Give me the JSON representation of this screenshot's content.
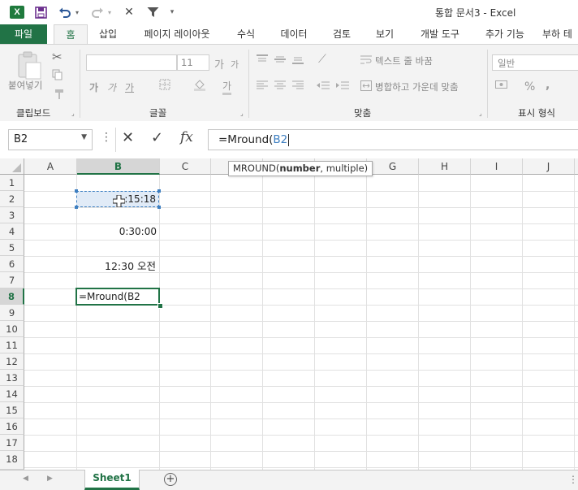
{
  "window": {
    "title": "통합 문서3 - Excel",
    "app_logo": "X"
  },
  "quick_access": {
    "icons": [
      "save-icon",
      "undo-icon",
      "redo-icon",
      "close-x-icon",
      "filter-icon",
      "customize-icon"
    ]
  },
  "ribbon_tabs": [
    "파일",
    "홈",
    "삽입",
    "페이지 레이아웃",
    "수식",
    "데이터",
    "검토",
    "보기",
    "개발 도구",
    "추가 기능",
    "부하 테"
  ],
  "ribbon": {
    "clipboard": {
      "label": "클립보드",
      "paste_label": "붙여넣기"
    },
    "font": {
      "label": "글꼴",
      "size_value": "11",
      "bold": "가",
      "italic": "가",
      "underline": "가",
      "font_color": "가",
      "increase": "가",
      "decrease": "가"
    },
    "alignment": {
      "label": "맞춤",
      "wrap_text": "텍스트 줄 바꿈",
      "merge_center": "병합하고 가운데 맞춤"
    },
    "number": {
      "label": "표시 형식",
      "format_value": "일반",
      "percent": "%",
      "comma": ","
    }
  },
  "formula_bar": {
    "name_box": "B2",
    "cancel_symbol": "✕",
    "enter_symbol": "✓",
    "fx_label": "fx",
    "formula_prefix": "=Mround(",
    "formula_ref": "B2"
  },
  "tooltip": {
    "func": "MROUND(",
    "arg_bold": "number",
    "rest": ", multiple)"
  },
  "columns": [
    "A",
    "B",
    "C",
    "D",
    "E",
    "F",
    "G",
    "H",
    "I",
    "J"
  ],
  "rows": [
    "1",
    "2",
    "3",
    "4",
    "5",
    "6",
    "7",
    "8",
    "9",
    "10",
    "11",
    "12",
    "13",
    "14",
    "15",
    "16",
    "17",
    "18"
  ],
  "cells": {
    "B2": ":15:18",
    "B4": "0:30:00",
    "B6": "12:30 오전",
    "B8_edit_prefix": "=Mround(",
    "B8_edit_ref": "B2"
  },
  "sheet_tabs": {
    "active": "Sheet1",
    "add_symbol": "+"
  },
  "colors": {
    "excel_green": "#217346",
    "ref_blue": "#3e7fc1",
    "selection_fill": "#e1ebf7"
  }
}
